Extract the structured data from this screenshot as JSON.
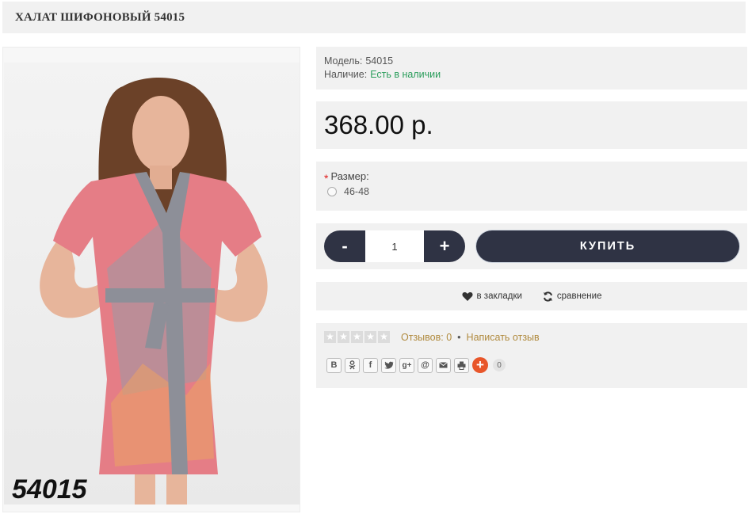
{
  "product": {
    "title": "ХАЛАТ ШИФОНОВЫЙ 54015",
    "photo_code": "54015",
    "model_label": "Модель:",
    "model_value": "54015",
    "availability_label": "Наличие:",
    "availability_value": "Есть в наличии",
    "price": "368.00 р."
  },
  "options": {
    "required_mark": "*",
    "size_label": "Размер:",
    "size_value": "46-48"
  },
  "cart": {
    "minus_label": "-",
    "quantity": "1",
    "plus_label": "+",
    "buy_label": "КУПИТЬ"
  },
  "actions": {
    "bookmark_label": "в закладки",
    "compare_label": "сравнение"
  },
  "reviews": {
    "rating_value": 0,
    "rating_max": 5,
    "count_label": "Отзывов: 0",
    "separator": "•",
    "write_label": "Написать отзыв"
  },
  "share": {
    "buttons": [
      "В",
      "ok-icon",
      "f",
      "twitter-icon",
      "g+",
      "@",
      "mail-icon",
      "print-icon"
    ],
    "plus_label": "+",
    "count": "0"
  },
  "colors": {
    "dark_button": "#2f3344",
    "stock_green": "#2a9d5b",
    "review_link": "#b08a3e",
    "share_plus": "#e8562a",
    "panel_bg": "#f1f1f1"
  }
}
